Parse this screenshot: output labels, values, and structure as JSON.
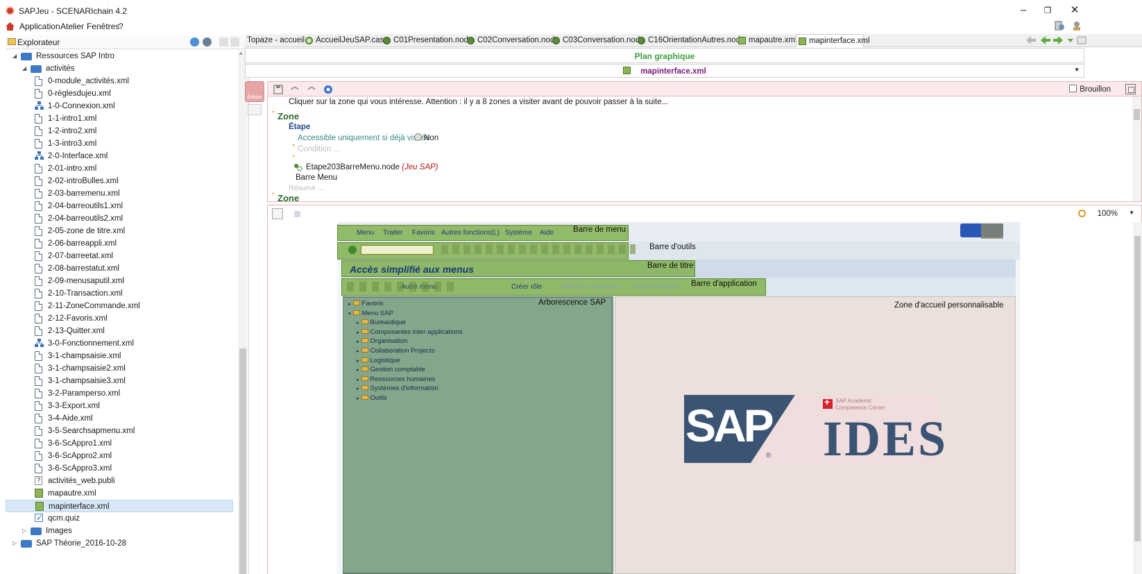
{
  "window": {
    "title": "SAPJeu - SCENARIchain 4.2"
  },
  "menubar": {
    "items": [
      "Application",
      "Atelier",
      "Fenêtres",
      "?"
    ]
  },
  "explorer": {
    "title": "Explorateur",
    "items": [
      {
        "label": "Ressources SAP Intro",
        "type": "folder",
        "level": 1,
        "expanded": true
      },
      {
        "label": "activités",
        "type": "folder",
        "level": 2,
        "expanded": true
      },
      {
        "label": "0-module_activités.xml",
        "type": "module",
        "level": 3
      },
      {
        "label": "0-règlesdujeu.xml",
        "type": "file",
        "level": 3
      },
      {
        "label": "1-0-Connexion.xml",
        "type": "net",
        "level": 3
      },
      {
        "label": "1-1-intro1.xml",
        "type": "file",
        "level": 3
      },
      {
        "label": "1-2-intro2.xml",
        "type": "file",
        "level": 3
      },
      {
        "label": "1-3-intro3.xml",
        "type": "file",
        "level": 3
      },
      {
        "label": "2-0-Interface.xml",
        "type": "net",
        "level": 3
      },
      {
        "label": "2-01-intro.xml",
        "type": "file",
        "level": 3
      },
      {
        "label": "2-02-introBulles.xml",
        "type": "file",
        "level": 3
      },
      {
        "label": "2-03-barremenu.xml",
        "type": "file",
        "level": 3
      },
      {
        "label": "2-04-barreoutils1.xml",
        "type": "file",
        "level": 3
      },
      {
        "label": "2-04-barreoutils2.xml",
        "type": "file",
        "level": 3
      },
      {
        "label": "2-05-zone de titre.xml",
        "type": "file",
        "level": 3
      },
      {
        "label": "2-06-barreappli.xml",
        "type": "file",
        "level": 3
      },
      {
        "label": "2-07-barreetat.xml",
        "type": "file",
        "level": 3
      },
      {
        "label": "2-08-barrestatut.xml",
        "type": "file",
        "level": 3
      },
      {
        "label": "2-09-menusaputil.xml",
        "type": "file",
        "level": 3
      },
      {
        "label": "2-10-Transaction.xml",
        "type": "file",
        "level": 3
      },
      {
        "label": "2-11-ZoneCommande.xml",
        "type": "file",
        "level": 3
      },
      {
        "label": "2-12-Favoris.xml",
        "type": "file",
        "level": 3
      },
      {
        "label": "2-13-Quitter.xml",
        "type": "file",
        "level": 3
      },
      {
        "label": "3-0-Fonctionnement.xml",
        "type": "net",
        "level": 3
      },
      {
        "label": "3-1-champsaisie.xml",
        "type": "file",
        "level": 3
      },
      {
        "label": "3-1-champsaisie2.xml",
        "type": "file",
        "level": 3
      },
      {
        "label": "3-1-champsaisie3.xml",
        "type": "file",
        "level": 3
      },
      {
        "label": "3-2-Paramperso.xml",
        "type": "file",
        "level": 3
      },
      {
        "label": "3-3-Export.xml",
        "type": "file",
        "level": 3
      },
      {
        "label": "3-4-Aide.xml",
        "type": "file",
        "level": 3
      },
      {
        "label": "3-5-Searchsapmenu.xml",
        "type": "file",
        "level": 3
      },
      {
        "label": "3-6-ScAppro1.xml",
        "type": "file",
        "level": 3
      },
      {
        "label": "3-6-ScAppro2.xml",
        "type": "file",
        "level": 3
      },
      {
        "label": "3-6-ScAppro3.xml",
        "type": "file",
        "level": 3
      },
      {
        "label": "activités_web.publi",
        "type": "publi",
        "level": 3
      },
      {
        "label": "mapautre.xml",
        "type": "map",
        "level": 3
      },
      {
        "label": "mapinterface.xml",
        "type": "map",
        "level": 3,
        "selected": true
      },
      {
        "label": "qcm.quiz",
        "type": "quiz",
        "level": 3
      },
      {
        "label": "Images",
        "type": "folder",
        "level": 2,
        "expanded": false
      },
      {
        "label": "SAP Théorie_2016-10-28",
        "type": "folder",
        "level": 1,
        "expanded": false
      }
    ]
  },
  "tabs": [
    {
      "label": "Topaze - accueil",
      "icon": "topaze-icon"
    },
    {
      "label": "AccueilJeuSAP.case",
      "icon": "case-icon"
    },
    {
      "label": "C01Presentation.node",
      "icon": "node-icon"
    },
    {
      "label": "C02Conversation.node",
      "icon": "node-icon"
    },
    {
      "label": "C03Conversation.node",
      "icon": "node-icon"
    },
    {
      "label": "C16OrientationAutres.node",
      "icon": "node-icon"
    },
    {
      "label": "mapautre.xml",
      "icon": "xml-icon"
    },
    {
      "label": "mapinterface.xml",
      "icon": "xml-icon",
      "active": true
    }
  ],
  "plan": {
    "title": "Plan graphique",
    "file": "mapinterface.xml"
  },
  "edbar": {
    "brouillon_label": "Brouillon",
    "edition_label": "Édition"
  },
  "doc": {
    "instruction": "Cliquer sur la zone qui vous intéresse. Attention : il y a 8 zones a visiter avant de pouvoir passer à la suite...",
    "zone1": "Zone",
    "etape": "Étape",
    "accessible": "Accessible uniquement si déjà visitée",
    "accessible_value": "Non",
    "condition": "Condition ...",
    "node": "Etape203BarreMenu.node",
    "node_jeu": "(Jeu SAP)",
    "barre_menu": "Barre Menu",
    "resume": "Résumé ...",
    "zone2": "Zone"
  },
  "graph": {
    "zoom": "100%"
  },
  "sap": {
    "menus": [
      "Menu",
      "Traiter",
      "Favoris",
      "Autres fonctions(L)",
      "Système",
      "Aide"
    ],
    "title": "Accès simplifié aux menus",
    "app_buttons": [
      "Autre menu",
      "Créer rôle",
      "Affecter utilisateurs",
      "Documentation"
    ],
    "zones": {
      "menu": "Barre de menu",
      "outils": "Barre d'outils",
      "titre": "Barre de titre",
      "application": "Barre d'application",
      "arbo": "Arborescence SAP",
      "accueil": "Zone d'accueil personnalisable"
    },
    "tree": [
      {
        "label": "Favoris",
        "level": 0
      },
      {
        "label": "Menu SAP",
        "level": 0
      },
      {
        "label": "Bureautique",
        "level": 1
      },
      {
        "label": "Composantes inter-applications",
        "level": 1
      },
      {
        "label": "Organisation",
        "level": 1
      },
      {
        "label": "Collaboration Projects",
        "level": 1
      },
      {
        "label": "Logistique",
        "level": 1
      },
      {
        "label": "Gestion comptable",
        "level": 1
      },
      {
        "label": "Ressources humaines",
        "level": 1
      },
      {
        "label": "Systèmes d'information",
        "level": 1
      },
      {
        "label": "Outils",
        "level": 1
      }
    ],
    "logo": {
      "sap": "SAP",
      "ides": "IDES",
      "academic": "SAP Academic",
      "competence": "Competence Center",
      "reg": "®"
    }
  }
}
